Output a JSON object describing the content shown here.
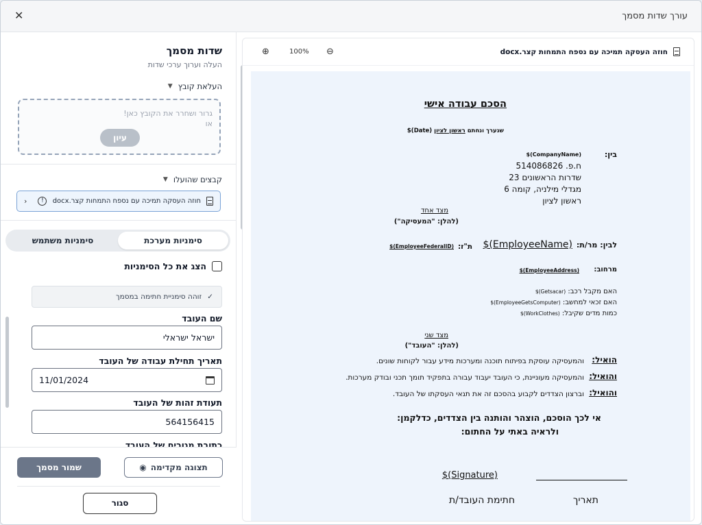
{
  "window": {
    "title": "עורך שדות מסמך",
    "close_symbol": "✕"
  },
  "panel": {
    "title": "שדות מסמך",
    "subtitle": "העלה וערוך ערכי שדות",
    "upload_section": "העלאת קובץ",
    "dropzone_hint": "גרור ושחרר את הקובץ כאן!",
    "dropzone_or": "או",
    "browse_label": "עיון",
    "uploaded_section": "קבצים שהועלו",
    "uploaded_file": "חוזה העסקה תמיכה עם נספח התמחות קצר.docx",
    "tabs": [
      "סימניות מערכת",
      "סימניות משתמש"
    ],
    "show_all_label": "הצג את כל הסימניות",
    "detected_notice": "זוהה סימניית חתימה במסמך",
    "fields": [
      {
        "label": "שם העובד",
        "value": "ישראל ישראלי"
      },
      {
        "label": "תאריך תחילת עבודה של העובד",
        "value": "11/01/2024"
      },
      {
        "label": "תעודת זהות של העובד",
        "value": "564156415"
      },
      {
        "label": "כתובת מגורים של העובד"
      }
    ],
    "save_label": "שמור מסמך",
    "preview_label": "תצוגה מקדימה",
    "close_label": "סגור"
  },
  "viewer": {
    "file_name": "חוזה העסקה תמיכה עם נספח התמחות קצר.docx",
    "zoom": "100%",
    "zoom_in_symbol": "⊕",
    "zoom_out_symbol": "⊖"
  },
  "document": {
    "title": "הסכם עבודה אישי",
    "made_prefix": "שנערך ונחתם",
    "made_city": "ראשון לציון",
    "made_date": "$(Date)",
    "between": "בין:",
    "company_name": "$(CompanyName)",
    "company_lines": [
      "ח.פ. 514086826",
      "שדרות הראשונים 23",
      "מגדלי מילניה, קומה 6",
      "ראשון לציון"
    ],
    "party_one": "מצד אחד",
    "party_one_alias": "(להלן: \"המעסיקה\")",
    "and_between": "לבין: מר/ת:",
    "employee_name": "$(EmployeeName)",
    "id_label": "ת\"ז:",
    "employee_id": "$(EmployeeFederalID)",
    "street_label": "מרחוב:",
    "employee_address": "$(EmployeeAddress)",
    "questions": [
      {
        "text": "האם מקבל רכב:",
        "value": "$(Getsacar)"
      },
      {
        "text": "האם זכאי למחשב:",
        "value": "$(EmployeeGetsComputer)"
      },
      {
        "text": "כמות מדים שקיבל:",
        "value": "$(WorkClothes)"
      }
    ],
    "party_two": "מצד שני",
    "party_two_alias": "(להלן: \"העובד\")",
    "whereas": [
      {
        "key": "הואיל:",
        "text": "והמעסיקה עוסקת בפיתוח תוכנה ומערכות מידע עבור לקוחות שונים."
      },
      {
        "key": "והואיל:",
        "text": "והמעסיקה מעוניינת, כי העובד יעבוד עבורה בתפקיד תומך תכני ובודק מערכות."
      },
      {
        "key": "והואיל:",
        "text": "וברצון הצדדים לקבוע בהסכם זה את תנאי העסקתו של העובד."
      }
    ],
    "conclusion": [
      "אי לכך הוסכם, הוצהר והותנה בין הצדדים, כדלקמן:",
      "ולראיה באתי על החתום:"
    ],
    "signature": "$(Signature)",
    "signature_label": "חתימת העובד/ת",
    "date_label": "תאריך"
  }
}
